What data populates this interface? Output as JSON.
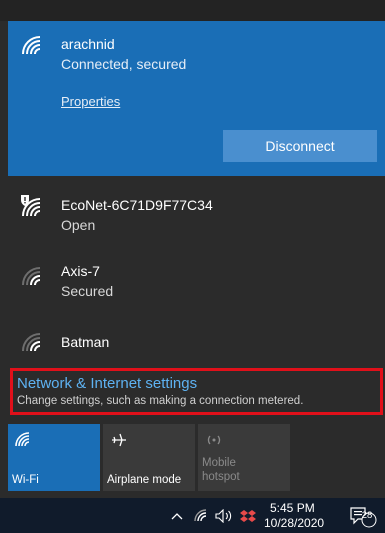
{
  "connected_network": {
    "name": "arachnid",
    "status": "Connected, secured",
    "properties_label": "Properties",
    "disconnect_label": "Disconnect"
  },
  "networks": [
    {
      "name": "EcoNet-6C71D9F77C34",
      "status": "Open"
    },
    {
      "name": "Axis-7",
      "status": "Secured"
    },
    {
      "name": "Batman",
      "status": ""
    }
  ],
  "settings": {
    "title": "Network & Internet settings",
    "subtitle": "Change settings, such as making a connection metered."
  },
  "quick_actions": [
    {
      "label": "Wi-Fi",
      "active": true
    },
    {
      "label": "Airplane mode",
      "active": false
    },
    {
      "label": "Mobile hotspot",
      "active": false,
      "disabled": true
    }
  ],
  "taskbar": {
    "time": "5:45 PM",
    "date": "10/28/2020",
    "notification_count": "28"
  },
  "colors": {
    "accent": "#1a6eb6",
    "link": "#5eb2f2",
    "highlight_border": "#e0101a"
  }
}
